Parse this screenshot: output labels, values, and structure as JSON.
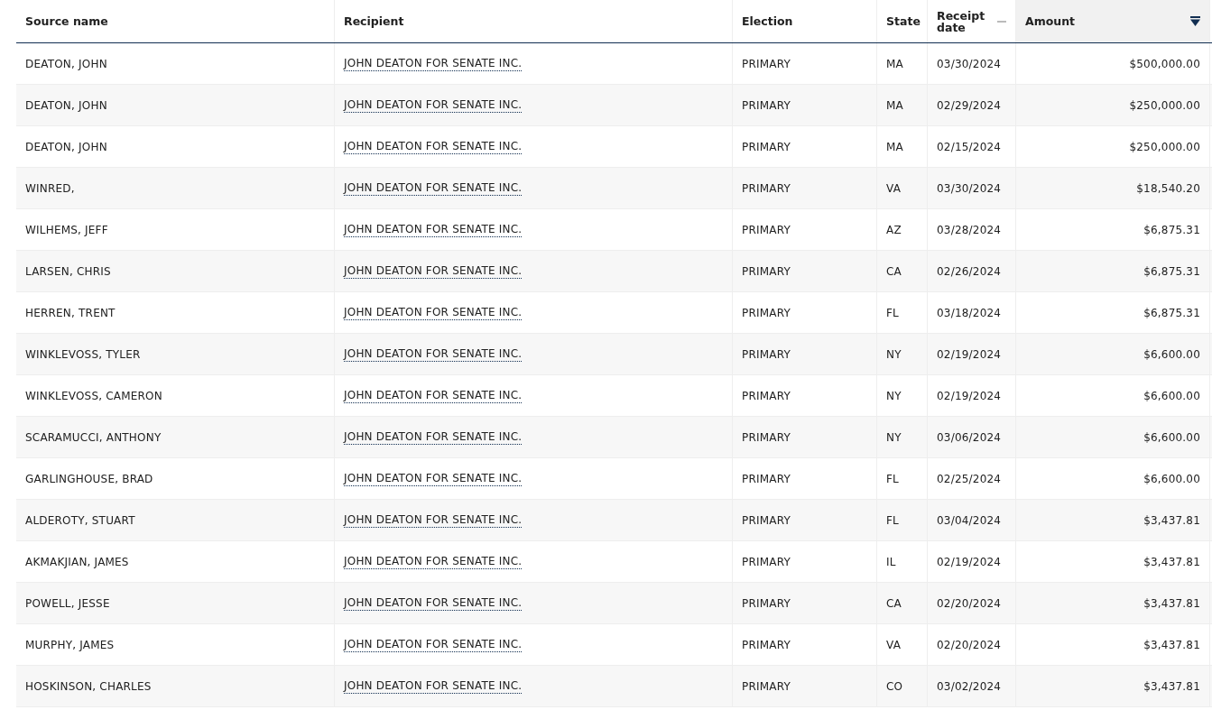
{
  "table": {
    "columns": [
      {
        "label": "Source name"
      },
      {
        "label": "Recipient"
      },
      {
        "label": "Election"
      },
      {
        "label": "State"
      },
      {
        "label": "Receipt date",
        "sorted": false
      },
      {
        "label": "Amount",
        "sorted": true,
        "descending": true
      }
    ],
    "rows": [
      {
        "source": "DEATON, JOHN",
        "recipient": "JOHN DEATON FOR SENATE INC.",
        "election": "PRIMARY",
        "state": "MA",
        "date": "03/30/2024",
        "amount": "$500,000.00"
      },
      {
        "source": "DEATON, JOHN",
        "recipient": "JOHN DEATON FOR SENATE INC.",
        "election": "PRIMARY",
        "state": "MA",
        "date": "02/29/2024",
        "amount": "$250,000.00"
      },
      {
        "source": "DEATON, JOHN",
        "recipient": "JOHN DEATON FOR SENATE INC.",
        "election": "PRIMARY",
        "state": "MA",
        "date": "02/15/2024",
        "amount": "$250,000.00"
      },
      {
        "source": "WINRED,",
        "recipient": "JOHN DEATON FOR SENATE INC.",
        "election": "PRIMARY",
        "state": "VA",
        "date": "03/30/2024",
        "amount": "$18,540.20"
      },
      {
        "source": "WILHEMS, JEFF",
        "recipient": "JOHN DEATON FOR SENATE INC.",
        "election": "PRIMARY",
        "state": "AZ",
        "date": "03/28/2024",
        "amount": "$6,875.31"
      },
      {
        "source": "LARSEN, CHRIS",
        "recipient": "JOHN DEATON FOR SENATE INC.",
        "election": "PRIMARY",
        "state": "CA",
        "date": "02/26/2024",
        "amount": "$6,875.31"
      },
      {
        "source": "HERREN, TRENT",
        "recipient": "JOHN DEATON FOR SENATE INC.",
        "election": "PRIMARY",
        "state": "FL",
        "date": "03/18/2024",
        "amount": "$6,875.31"
      },
      {
        "source": "WINKLEVOSS, TYLER",
        "recipient": "JOHN DEATON FOR SENATE INC.",
        "election": "PRIMARY",
        "state": "NY",
        "date": "02/19/2024",
        "amount": "$6,600.00"
      },
      {
        "source": "WINKLEVOSS, CAMERON",
        "recipient": "JOHN DEATON FOR SENATE INC.",
        "election": "PRIMARY",
        "state": "NY",
        "date": "02/19/2024",
        "amount": "$6,600.00"
      },
      {
        "source": "SCARAMUCCI, ANTHONY",
        "recipient": "JOHN DEATON FOR SENATE INC.",
        "election": "PRIMARY",
        "state": "NY",
        "date": "03/06/2024",
        "amount": "$6,600.00"
      },
      {
        "source": "GARLINGHOUSE, BRAD",
        "recipient": "JOHN DEATON FOR SENATE INC.",
        "election": "PRIMARY",
        "state": "FL",
        "date": "02/25/2024",
        "amount": "$6,600.00"
      },
      {
        "source": "ALDEROTY, STUART",
        "recipient": "JOHN DEATON FOR SENATE INC.",
        "election": "PRIMARY",
        "state": "FL",
        "date": "03/04/2024",
        "amount": "$3,437.81"
      },
      {
        "source": "AKMAKJIAN, JAMES",
        "recipient": "JOHN DEATON FOR SENATE INC.",
        "election": "PRIMARY",
        "state": "IL",
        "date": "02/19/2024",
        "amount": "$3,437.81"
      },
      {
        "source": "POWELL, JESSE",
        "recipient": "JOHN DEATON FOR SENATE INC.",
        "election": "PRIMARY",
        "state": "CA",
        "date": "02/20/2024",
        "amount": "$3,437.81"
      },
      {
        "source": "MURPHY, JAMES",
        "recipient": "JOHN DEATON FOR SENATE INC.",
        "election": "PRIMARY",
        "state": "VA",
        "date": "02/20/2024",
        "amount": "$3,437.81"
      },
      {
        "source": "HOSKINSON, CHARLES",
        "recipient": "JOHN DEATON FOR SENATE INC.",
        "election": "PRIMARY",
        "state": "CO",
        "date": "03/02/2024",
        "amount": "$3,437.81"
      }
    ]
  }
}
